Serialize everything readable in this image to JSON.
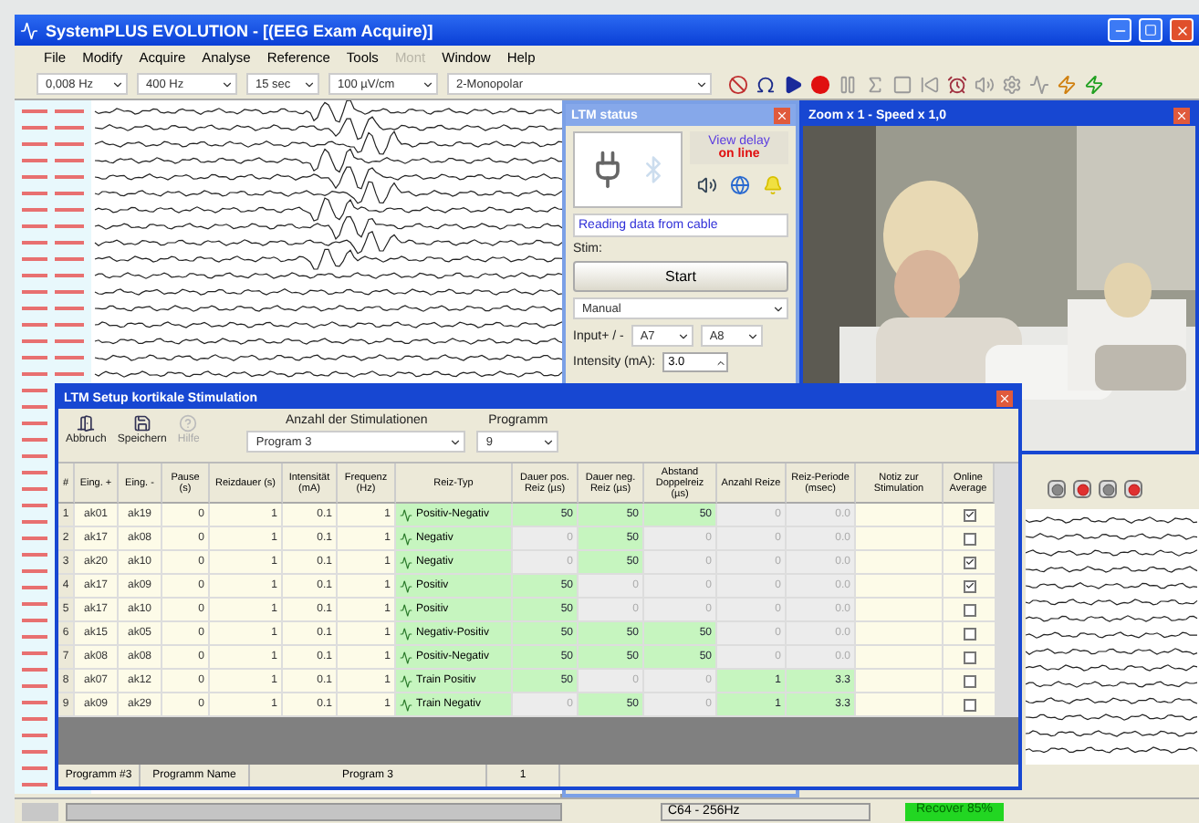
{
  "window": {
    "title": "SystemPLUS EVOLUTION - [(EEG Exam Acquire)]"
  },
  "menu": [
    {
      "label": "File",
      "disabled": false
    },
    {
      "label": "Modify",
      "disabled": false
    },
    {
      "label": "Acquire",
      "disabled": false
    },
    {
      "label": "Analyse",
      "disabled": false
    },
    {
      "label": "Reference",
      "disabled": false
    },
    {
      "label": "Tools",
      "disabled": false
    },
    {
      "label": "Mont",
      "disabled": true
    },
    {
      "label": "Window",
      "disabled": false
    },
    {
      "label": "Help",
      "disabled": false
    }
  ],
  "toolbar": {
    "selects": [
      "0,008 Hz",
      "400 Hz",
      "15 sec",
      "100 µV/cm",
      "2-Monopolar"
    ]
  },
  "ltm_status": {
    "title": "LTM status",
    "view_delay": "View delay",
    "connection": "on line",
    "message": "Reading data from cable",
    "stim_label": "Stim:",
    "start_button": "Start",
    "mode": "Manual",
    "input_label": "Input+ / -",
    "input_plus": "A7",
    "input_minus": "A8",
    "intensity_label": "Intensity (mA):",
    "intensity": "3.0"
  },
  "zoom_window": {
    "title": "Zoom x 1 - Speed x 1,0"
  },
  "setup_window": {
    "title": "LTM Setup kortikale Stimulation",
    "buttons": [
      {
        "label": "Abbruch",
        "disabled": false
      },
      {
        "label": "Speichern",
        "disabled": false
      },
      {
        "label": "Hilfe",
        "disabled": true
      }
    ],
    "count_label": "Anzahl der Stimulationen",
    "count_value": "Program 3",
    "program_label": "Programm",
    "program_value": "9",
    "columns": [
      "#",
      "Eing. +",
      "Eing. -",
      "Pause (s)",
      "Reizdauer (s)",
      "Intensität (mA)",
      "Frequenz (Hz)",
      "Reiz-Typ",
      "Dauer pos. Reiz (µs)",
      "Dauer neg. Reiz (µs)",
      "Abstand Doppelreiz (µs)",
      "Anzahl Reize",
      "Reiz-Periode (msec)",
      "Notiz zur Stimulation",
      "Online Average"
    ],
    "rows": [
      {
        "cells": [
          "1",
          "ak01",
          "ak19",
          "0",
          "1",
          "0.1",
          "1"
        ],
        "type": "Positiv-Negativ",
        "stim": [
          {
            "text": "50",
            "enabled": true
          },
          {
            "text": "50",
            "enabled": true
          },
          {
            "text": "50",
            "enabled": true
          },
          {
            "text": "0",
            "enabled": false
          },
          {
            "text": "0.0",
            "enabled": false
          }
        ],
        "online_average": true
      },
      {
        "cells": [
          "2",
          "ak17",
          "ak08",
          "0",
          "1",
          "0.1",
          "1"
        ],
        "type": "Negativ",
        "stim": [
          {
            "text": "0",
            "enabled": false
          },
          {
            "text": "50",
            "enabled": true
          },
          {
            "text": "0",
            "enabled": false
          },
          {
            "text": "0",
            "enabled": false
          },
          {
            "text": "0.0",
            "enabled": false
          }
        ],
        "online_average": false
      },
      {
        "cells": [
          "3",
          "ak20",
          "ak10",
          "0",
          "1",
          "0.1",
          "1"
        ],
        "type": "Negativ",
        "stim": [
          {
            "text": "0",
            "enabled": false
          },
          {
            "text": "50",
            "enabled": true
          },
          {
            "text": "0",
            "enabled": false
          },
          {
            "text": "0",
            "enabled": false
          },
          {
            "text": "0.0",
            "enabled": false
          }
        ],
        "online_average": true
      },
      {
        "cells": [
          "4",
          "ak17",
          "ak09",
          "0",
          "1",
          "0.1",
          "1"
        ],
        "type": "Positiv",
        "stim": [
          {
            "text": "50",
            "enabled": true
          },
          {
            "text": "0",
            "enabled": false
          },
          {
            "text": "0",
            "enabled": false
          },
          {
            "text": "0",
            "enabled": false
          },
          {
            "text": "0.0",
            "enabled": false
          }
        ],
        "online_average": true
      },
      {
        "cells": [
          "5",
          "ak17",
          "ak10",
          "0",
          "1",
          "0.1",
          "1"
        ],
        "type": "Positiv",
        "stim": [
          {
            "text": "50",
            "enabled": true
          },
          {
            "text": "0",
            "enabled": false
          },
          {
            "text": "0",
            "enabled": false
          },
          {
            "text": "0",
            "enabled": false
          },
          {
            "text": "0.0",
            "enabled": false
          }
        ],
        "online_average": false
      },
      {
        "cells": [
          "6",
          "ak15",
          "ak05",
          "0",
          "1",
          "0.1",
          "1"
        ],
        "type": "Negativ-Positiv",
        "stim": [
          {
            "text": "50",
            "enabled": true
          },
          {
            "text": "50",
            "enabled": true
          },
          {
            "text": "50",
            "enabled": true
          },
          {
            "text": "0",
            "enabled": false
          },
          {
            "text": "0.0",
            "enabled": false
          }
        ],
        "online_average": false
      },
      {
        "cells": [
          "7",
          "ak08",
          "ak08",
          "0",
          "1",
          "0.1",
          "1"
        ],
        "type": "Positiv-Negativ",
        "stim": [
          {
            "text": "50",
            "enabled": true
          },
          {
            "text": "50",
            "enabled": true
          },
          {
            "text": "50",
            "enabled": true
          },
          {
            "text": "0",
            "enabled": false
          },
          {
            "text": "0.0",
            "enabled": false
          }
        ],
        "online_average": false
      },
      {
        "cells": [
          "8",
          "ak07",
          "ak12",
          "0",
          "1",
          "0.1",
          "1"
        ],
        "type": "Train Positiv",
        "stim": [
          {
            "text": "50",
            "enabled": true
          },
          {
            "text": "0",
            "enabled": false
          },
          {
            "text": "0",
            "enabled": false
          },
          {
            "text": "1",
            "enabled": true
          },
          {
            "text": "3.3",
            "enabled": true
          }
        ],
        "online_average": false
      },
      {
        "cells": [
          "9",
          "ak09",
          "ak29",
          "0",
          "1",
          "0.1",
          "1"
        ],
        "type": "Train Negativ",
        "stim": [
          {
            "text": "0",
            "enabled": false
          },
          {
            "text": "50",
            "enabled": true
          },
          {
            "text": "0",
            "enabled": false
          },
          {
            "text": "1",
            "enabled": true
          },
          {
            "text": "3.3",
            "enabled": true
          }
        ],
        "online_average": false
      }
    ],
    "footer": [
      "Programm #3",
      "Programm Name",
      "Program 3",
      "1"
    ]
  },
  "status_bar": {
    "rate": "C64 - 256Hz",
    "recorder": "Recover 85%"
  }
}
